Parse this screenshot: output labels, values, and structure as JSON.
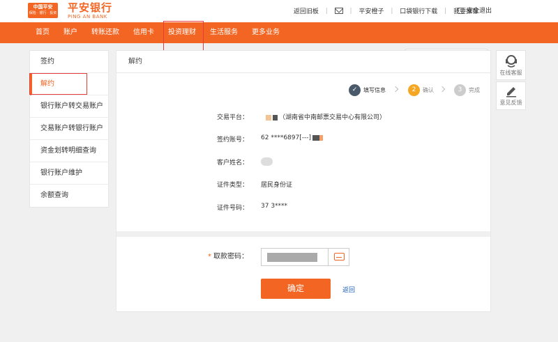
{
  "brand": {
    "badge_top": "中国平安",
    "badge_bottom": "保险 · 银行 · 投资",
    "name_cn": "平安银行",
    "name_en": "PING AN BANK"
  },
  "toplinks": {
    "old_version": "返回旧板",
    "pingan_orange": "平安橙子",
    "pocket_bank": "口袋银行下载",
    "recommend": "我要推荐",
    "logout": "安全退出"
  },
  "nav": {
    "items": [
      "首页",
      "账户",
      "转账还款",
      "信用卡",
      "投资理财",
      "生活服务",
      "更多业务"
    ],
    "active_index": 4
  },
  "search": {
    "placeholder": ""
  },
  "sidebar": {
    "items": [
      "签约",
      "解约",
      "银行账户转交易账户",
      "交易账户转银行账户",
      "资金划转明细查询",
      "银行账户维护",
      "余额查询"
    ],
    "active_index": 1
  },
  "main": {
    "title": "解约",
    "steps": [
      {
        "num": "✓",
        "label": "填写信息",
        "state": "done"
      },
      {
        "num": "2",
        "label": "确认",
        "state": "current"
      },
      {
        "num": "3",
        "label": "完成",
        "state": "todo"
      }
    ],
    "fields": [
      {
        "label": "交易平台：",
        "value": "（湖南省中南邮票交易中心有限公司）"
      },
      {
        "label": "签约账号：",
        "value": "62 ****6897[---]"
      },
      {
        "label": "客户姓名：",
        "value": ""
      },
      {
        "label": "证件类型：",
        "value": "居民身份证"
      },
      {
        "label": "证件号码：",
        "value": "37 3****"
      }
    ],
    "password_label": "取款密码：",
    "password_required_mark": "*",
    "confirm_button": "确定",
    "back_link": "返回"
  },
  "right_tools": {
    "service": "在线客服",
    "feedback": "意见反馈"
  },
  "colors": {
    "brand_orange": "#f26522",
    "step_done": "#4a5a6a",
    "link_blue": "#1e5fb4",
    "highlight_red": "#e63c3c"
  }
}
